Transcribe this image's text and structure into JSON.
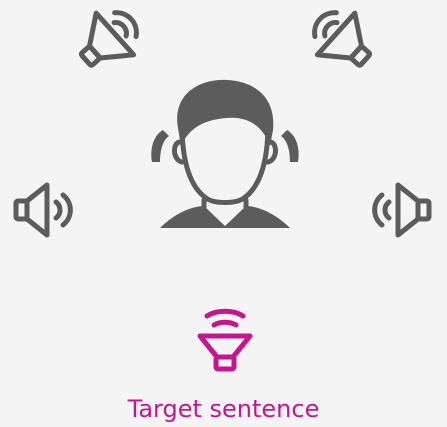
{
  "caption": "Target sentence",
  "colors": {
    "background": "#f4f4f4",
    "speaker_gray": "#5c5c5c",
    "target_accent": "#c4168f"
  },
  "icons": {
    "speakers": [
      "speaker-top-left-icon",
      "speaker-top-right-icon",
      "speaker-left-icon",
      "speaker-right-icon"
    ],
    "listener": "listener-head-icon",
    "hearing_aids": [
      "hearing-aid-left-icon",
      "hearing-aid-right-icon"
    ],
    "target": "target-speaker-icon"
  }
}
